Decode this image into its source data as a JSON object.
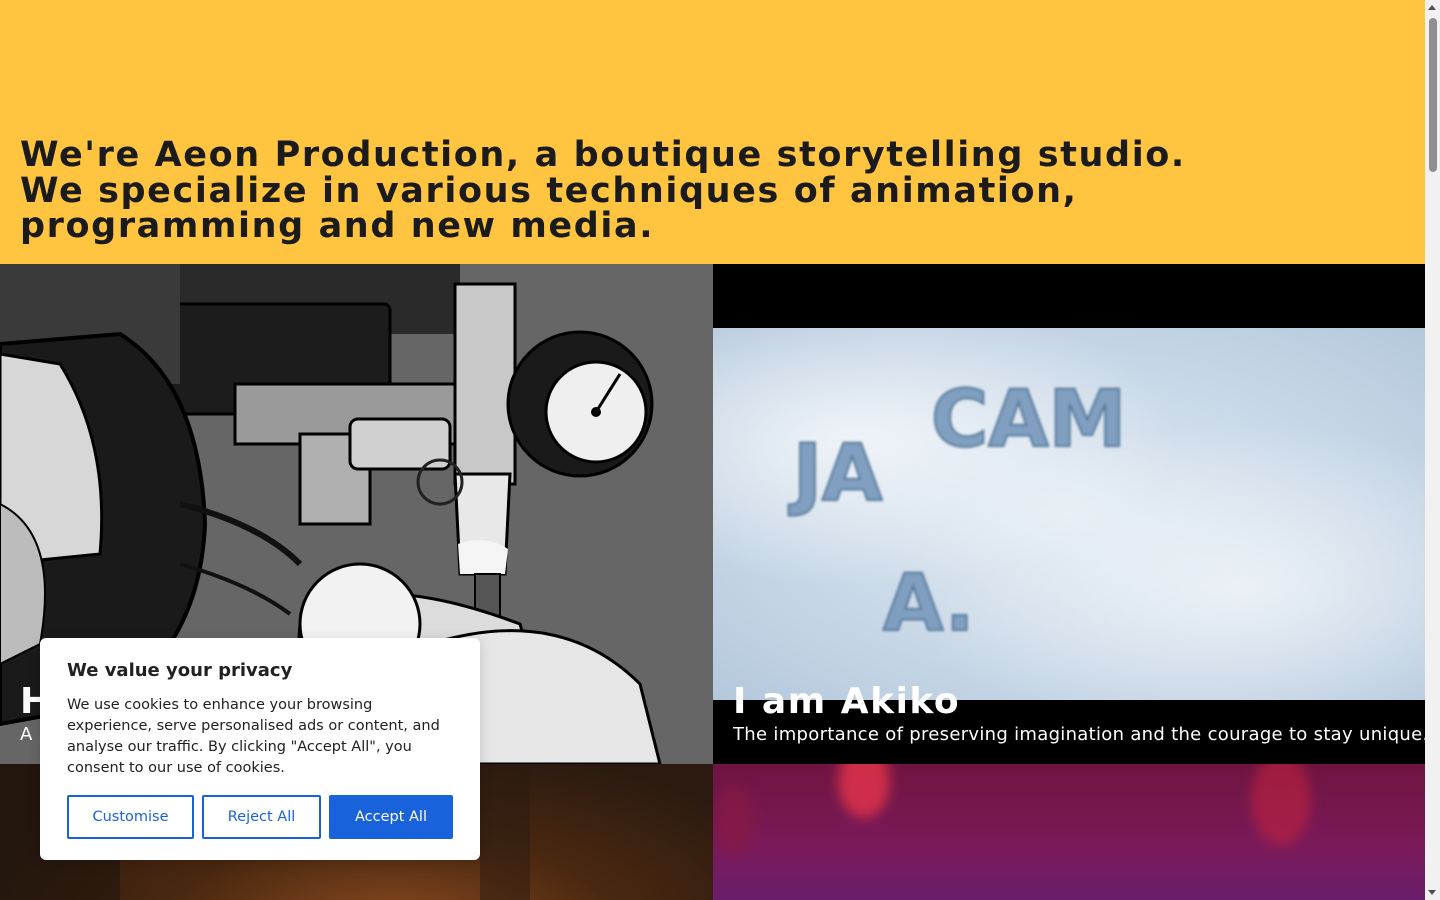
{
  "hero": {
    "line1": "We're Aeon Production, a boutique storytelling studio.",
    "line2": "We specialize in various techniques of animation,",
    "line3": "programming and new media."
  },
  "projects": [
    {
      "title": "H",
      "subtitle": "A",
      "image": "anime-pressure-gauge-machinery"
    },
    {
      "title": "I am Akiko",
      "subtitle": "The importance of preserving imagination and the courage to stay unique.",
      "image": "snow-lettering",
      "image_text": [
        "JA",
        "CAM",
        "A."
      ]
    },
    {
      "image": "warm-orange-glow"
    },
    {
      "image": "magenta-bokeh"
    }
  ],
  "cookie_banner": {
    "title": "We value your privacy",
    "text": "We use cookies to enhance your browsing experience, serve personalised ads or content, and analyse our traffic. By clicking \"Accept All\", you consent to our use of cookies.",
    "buttons": {
      "customise": "Customise",
      "reject": "Reject All",
      "accept": "Accept All"
    },
    "accent_color": "#1863dc"
  },
  "colors": {
    "hero_background": "#ffc440",
    "hero_text": "#1b1b1b"
  }
}
